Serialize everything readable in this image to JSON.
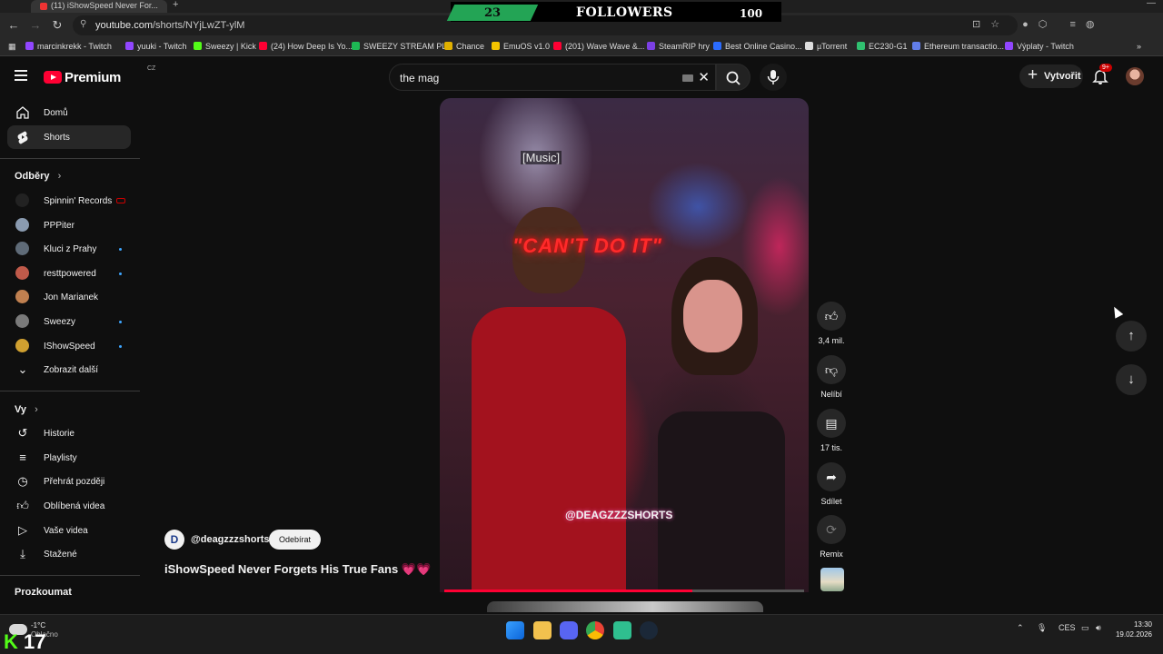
{
  "browser": {
    "tab_title": "(11) iShowSpeed Never For...",
    "url_host": "youtube.com",
    "url_path": "/shorts/NYjLwZT-ylM"
  },
  "overlay": {
    "follower_count": "23",
    "label": "FOLLOWERS",
    "goal": "100",
    "accent_color": "#23a455"
  },
  "bookmarks": [
    {
      "label": "marcinkrekk - Twitch",
      "color": "#9146ff"
    },
    {
      "label": "yuuki - Twitch",
      "color": "#9146ff"
    },
    {
      "label": "Sweezy | Kick",
      "color": "#53fc18"
    },
    {
      "label": "(24) How Deep Is Yo...",
      "color": "#ff0033"
    },
    {
      "label": "SWEEZY STREAM PL...",
      "color": "#1db954"
    },
    {
      "label": "Chance",
      "color": "#e0b000"
    },
    {
      "label": "EmuOS v1.0",
      "color": "#f5c400"
    },
    {
      "label": "(201) Wave Wave &...",
      "color": "#ff0033"
    },
    {
      "label": "SteamRIP hry",
      "color": "#7b3fe4"
    },
    {
      "label": "Best Online Casino...",
      "color": "#2b6cff"
    },
    {
      "label": "µTorrent",
      "color": "#dddddd"
    },
    {
      "label": "EC230-G1",
      "color": "#30c070"
    },
    {
      "label": "Ethereum transactio...",
      "color": "#627eea"
    },
    {
      "label": "Výplaty - Twitch",
      "color": "#9146ff"
    }
  ],
  "header": {
    "logo_text": "Premium",
    "country_code": "CZ",
    "search_value": "the mag",
    "create_label": "Vytvořit",
    "notifications_badge": "9+"
  },
  "sidebar": {
    "main_items": [
      {
        "label": "Domů",
        "icon": "home-icon"
      },
      {
        "label": "Shorts",
        "icon": "shorts-icon"
      }
    ],
    "subscriptions_heading": "Odběry",
    "subscriptions": [
      {
        "label": "Spinnin' Records",
        "status": "live-recording",
        "avatar_color": "#222222"
      },
      {
        "label": "PPPiter",
        "status": "",
        "avatar_color": "#8a9bb0"
      },
      {
        "label": "Kluci z Prahy",
        "status": "new",
        "avatar_color": "#5f6b78"
      },
      {
        "label": "resttpowered",
        "status": "new",
        "avatar_color": "#c05a4a"
      },
      {
        "label": "Jon Marianek",
        "status": "",
        "avatar_color": "#c08050"
      },
      {
        "label": "Sweezy",
        "status": "new",
        "avatar_color": "#7a7a7a"
      },
      {
        "label": "IShowSpeed",
        "status": "new",
        "avatar_color": "#d0a030"
      }
    ],
    "show_more": "Zobrazit další",
    "you_heading": "Vy",
    "you_items": [
      {
        "label": "Historie",
        "icon": "history-icon"
      },
      {
        "label": "Playlisty",
        "icon": "playlists-icon"
      },
      {
        "label": "Přehrát později",
        "icon": "watch-later-icon"
      },
      {
        "label": "Oblíbená videa",
        "icon": "liked-videos-icon"
      },
      {
        "label": "Vaše videa",
        "icon": "your-videos-icon"
      },
      {
        "label": "Stažené",
        "icon": "downloads-icon"
      }
    ],
    "explore_heading": "Prozkoumat"
  },
  "short": {
    "subtitle_text": "[Music]",
    "caption_text": "\"CAN'T DO IT\"",
    "watermark": "@DEAGZZZSHORTS",
    "progress": 0.69,
    "channel_initial": "D",
    "channel": "@deagzzzshorts",
    "subscribe_label": "Odebírat",
    "title": "iShowSpeed Never Forgets His True Fans 💗💗",
    "actions": {
      "like_count": "3,4 mil.",
      "dislike_label": "Nelíbí",
      "comments_count": "17 tis.",
      "share_label": "Sdílet",
      "remix_label": "Remix"
    }
  },
  "taskbar": {
    "temperature": "-1°C",
    "weather_text": "Oblačno",
    "kick_count": "17",
    "language": "CES",
    "time": "13:30",
    "date": "19.02.2026"
  }
}
